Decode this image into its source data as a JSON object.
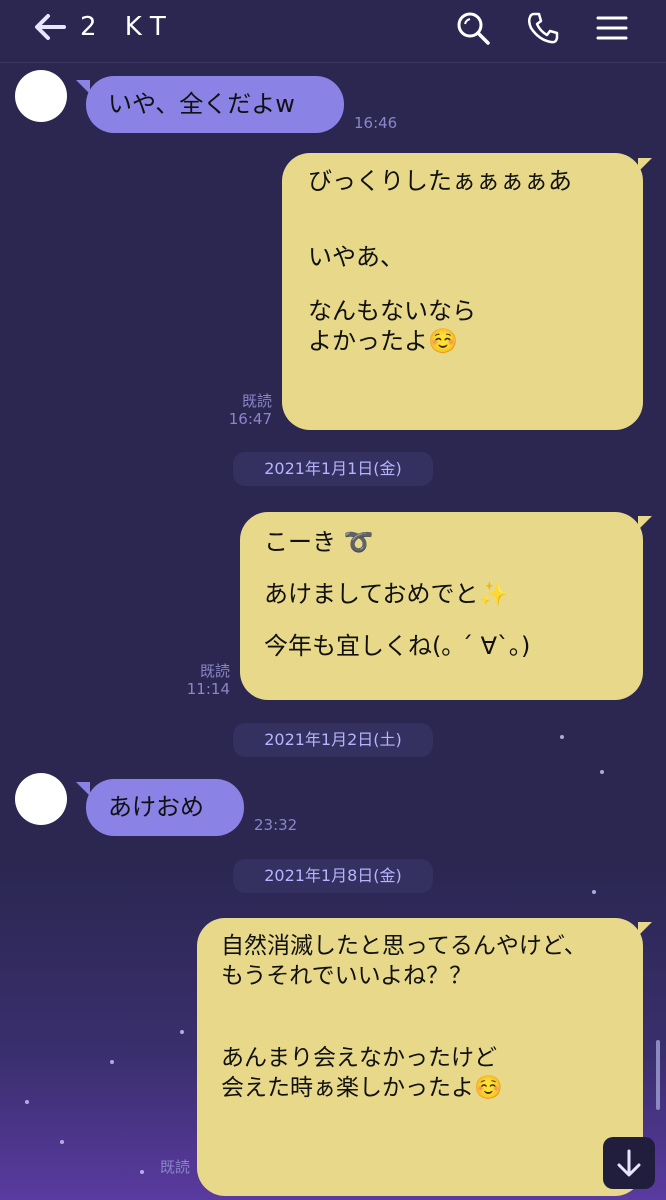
{
  "header": {
    "back_icon": "arrow-left-icon",
    "title": "2 KT",
    "search_icon": "search-icon",
    "call_icon": "phone-icon",
    "menu_icon": "menu-icon"
  },
  "messages": [
    {
      "type": "in",
      "lines": [
        "いや、全くだよw"
      ],
      "time": "16:46"
    },
    {
      "type": "out",
      "lines": [
        "びっくりしたぁぁぁぁあ",
        "",
        "いやあ、",
        "",
        "なんもないなら",
        "よかったよ☺️"
      ],
      "read": "既読",
      "time": "16:47"
    },
    {
      "type": "date",
      "label": "2021年1月1日(金)"
    },
    {
      "type": "out",
      "lines": [
        "こーき ➰",
        "",
        "あけましておめでと✨",
        "",
        "今年も宜しくね(｡ ´ ∀`｡)"
      ],
      "read": "既読",
      "time": "11:14"
    },
    {
      "type": "date",
      "label": "2021年1月2日(土)"
    },
    {
      "type": "in",
      "lines": [
        "あけおめ"
      ],
      "time": "23:32"
    },
    {
      "type": "date",
      "label": "2021年1月8日(金)"
    },
    {
      "type": "out",
      "lines": [
        "自然消滅したと思ってるんやけど、",
        "もうそれでいいよね？？",
        "",
        "",
        "あんまり会えなかったけど",
        "会えた時ぁ楽しかったよ☺️"
      ],
      "read": "既読",
      "time": ""
    }
  ],
  "scroll_down_icon": "arrow-down-icon",
  "colors": {
    "background": "#2b2751",
    "incoming_bubble": "#8b82e6",
    "outgoing_bubble": "#e8d98a",
    "meta_text": "#8a86c8"
  }
}
